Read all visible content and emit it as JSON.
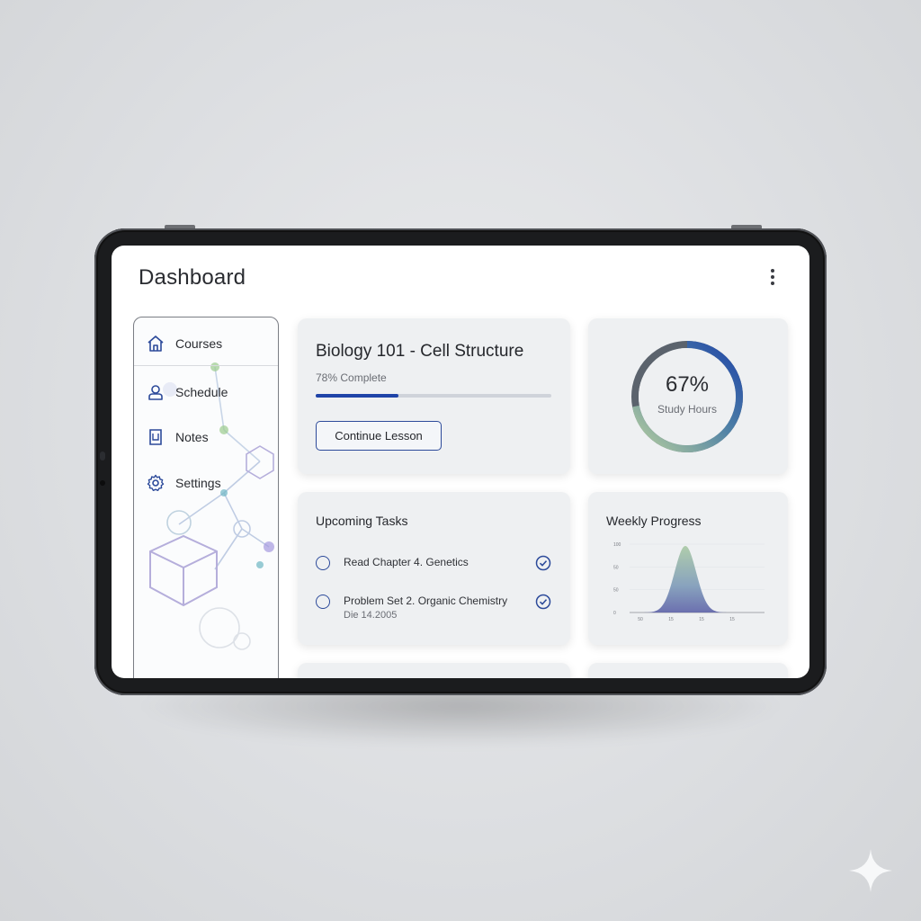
{
  "header": {
    "title": "Dashboard",
    "menu_icon": "kebab-icon"
  },
  "sidebar": {
    "items": [
      {
        "label": "Courses",
        "icon": "home-icon"
      },
      {
        "label": "Schedule",
        "icon": "user-icon"
      },
      {
        "label": "Notes",
        "icon": "notes-icon"
      },
      {
        "label": "Settings",
        "icon": "gear-icon"
      }
    ]
  },
  "course_card": {
    "title": "Biology 101 - Cell Structure",
    "progress_text": "78% Complete",
    "progress": 0.35,
    "button_label": "Continue Lesson"
  },
  "study_hours": {
    "percent_text": "67%",
    "label": "Study Hours",
    "value": 0.67
  },
  "tasks_card": {
    "heading": "Upcoming Tasks",
    "tasks": [
      {
        "title": "Read Chapter 4. Genetics",
        "subtitle": ""
      },
      {
        "title": "Problem Set 2. Organic Chemistry",
        "subtitle": "Die 14.2005"
      }
    ]
  },
  "weekly_progress": {
    "heading": "Weekly Progress"
  },
  "chart_data": {
    "type": "area",
    "title": "Weekly Progress",
    "y_ticks": [
      "100",
      "50",
      "50",
      "0"
    ],
    "x_ticks": [
      "50",
      "15",
      "15",
      "15"
    ],
    "shape": "bell-curve"
  },
  "colors": {
    "accent": "#1f44a8",
    "ring_start": "#a8c49a",
    "ring_end": "#1f44a8",
    "ring_track": "#5b636d",
    "card_bg": "#eef0f2"
  }
}
